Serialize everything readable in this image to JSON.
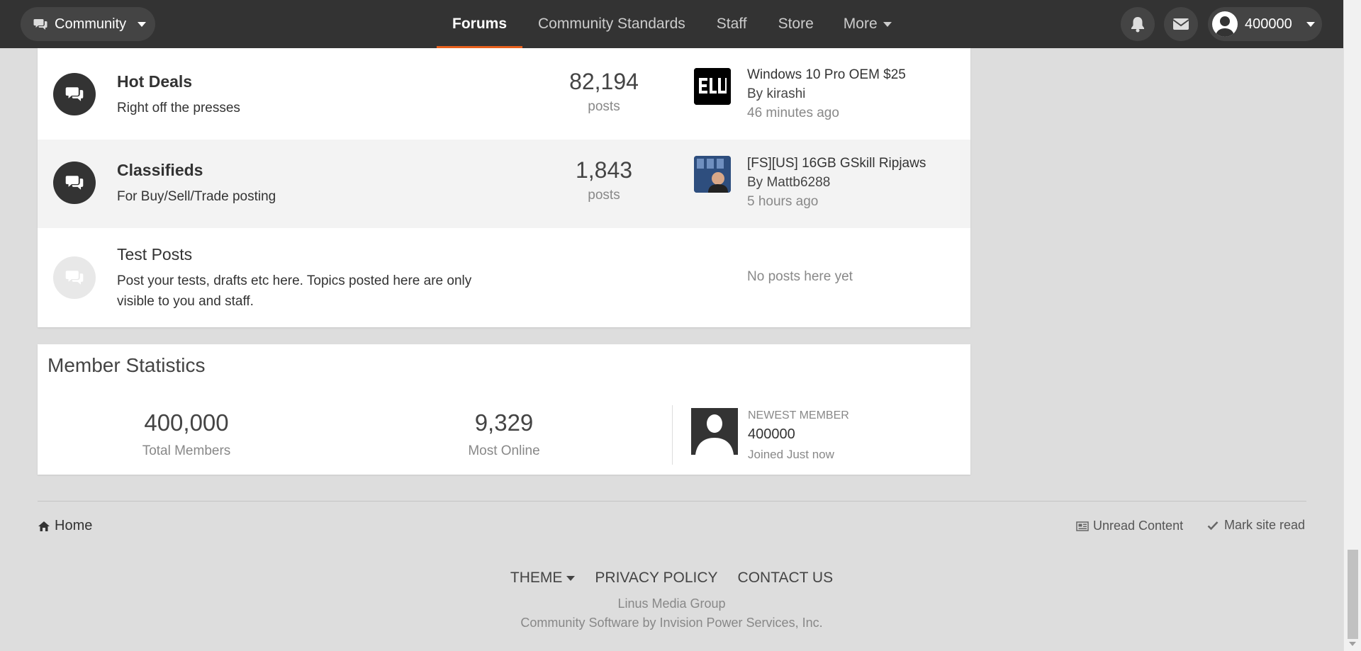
{
  "topbar": {
    "community_label": "Community",
    "nav": [
      {
        "label": "Forums",
        "active": true
      },
      {
        "label": "Community Standards",
        "active": false
      },
      {
        "label": "Staff",
        "active": false
      },
      {
        "label": "Store",
        "active": false
      },
      {
        "label": "More",
        "active": false
      }
    ],
    "username": "400000",
    "accent_color": "#e8601c"
  },
  "forums": [
    {
      "title": "Hot Deals",
      "description": "Right off the presses",
      "posts_count": "82,194",
      "posts_label": "posts",
      "last_post_title": "Windows 10 Pro OEM $25",
      "last_post_by_prefix": "By",
      "last_post_author": "kirashi",
      "last_post_time": "46 minutes ago"
    },
    {
      "title": "Classifieds",
      "description": "For Buy/Sell/Trade posting",
      "posts_count": "1,843",
      "posts_label": "posts",
      "last_post_title": "[FS][US] 16GB GSkill Ripjaws",
      "last_post_by_prefix": "By",
      "last_post_author": "Mattb6288",
      "last_post_time": "5 hours ago"
    },
    {
      "title": "Test Posts",
      "description": "Post your tests, drafts etc here. Topics posted here are only visible to you and staff.",
      "empty_text": "No posts here yet"
    }
  ],
  "member_stats": {
    "title": "Member Statistics",
    "total_members": "400,000",
    "total_members_label": "Total Members",
    "most_online": "9,329",
    "most_online_label": "Most Online",
    "newest_label": "Newest Member",
    "newest_name": "400000",
    "newest_joined": "Joined Just now"
  },
  "footer": {
    "home": "Home",
    "unread": "Unread Content",
    "mark_read": "Mark site read",
    "theme": "THEME",
    "privacy": "PRIVACY POLICY",
    "contact": "CONTACT US",
    "copyright_1": "Linus Media Group",
    "copyright_2": "Community Software by Invision Power Services, Inc."
  }
}
